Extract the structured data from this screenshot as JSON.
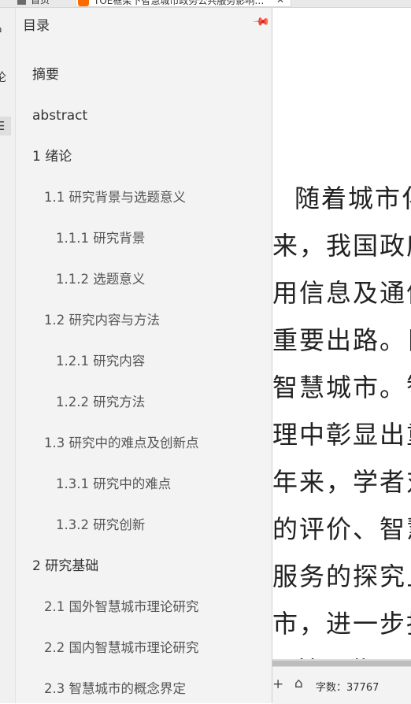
{
  "browser": {
    "tab1_label": "首页",
    "tab2_label": "TOE框架下智慧城市政务公共服务影响因素研究",
    "tab2_close": "✕"
  },
  "left_rail": {
    "items": [
      {
        "name": "home-icon",
        "glyph": "⌂"
      },
      {
        "name": "comment-icon",
        "glyph": "论"
      },
      {
        "name": "outline-icon",
        "glyph": "☰"
      }
    ]
  },
  "toc": {
    "title": "目录",
    "pin_glyph": "📌",
    "items": [
      {
        "label": "摘要",
        "level": 1
      },
      {
        "label": "abstract",
        "level": 1
      },
      {
        "label": "1 绪论",
        "level": 1
      },
      {
        "label": "1.1 研究背景与选题意义",
        "level": 2
      },
      {
        "label": "1.1.1 研究背景",
        "level": 3
      },
      {
        "label": "1.1.2 选题意义",
        "level": 3
      },
      {
        "label": "1.2 研究内容与方法",
        "level": 2
      },
      {
        "label": "1.2.1 研究内容",
        "level": 3
      },
      {
        "label": "1.2.2 研究方法",
        "level": 3
      },
      {
        "label": "1.3 研究中的难点及创新点",
        "level": 2
      },
      {
        "label": "1.3.1 研究中的难点",
        "level": 3
      },
      {
        "label": "1.3.2 研究创新",
        "level": 3
      },
      {
        "label": "2 研究基础",
        "level": 1
      },
      {
        "label": "2.1 国外智慧城市理论研究",
        "level": 2
      },
      {
        "label": "2.2 国内智慧城市理论研究",
        "level": 2
      },
      {
        "label": "2.3 智慧城市的概念界定",
        "level": 2
      }
    ]
  },
  "document": {
    "lines": [
      "随着城市化",
      "来，我国政府",
      "用信息及通信",
      "重要出路。目",
      "智慧城市。智",
      "理中彰显出重",
      "年来，学者对",
      "的评价、智慧",
      "服务的探究旦",
      "市，进一步指",
      "基于此，"
    ]
  },
  "status_bar": {
    "add_glyph": "+",
    "home_glyph": "⌂",
    "word_count_label": "字数：37767"
  }
}
